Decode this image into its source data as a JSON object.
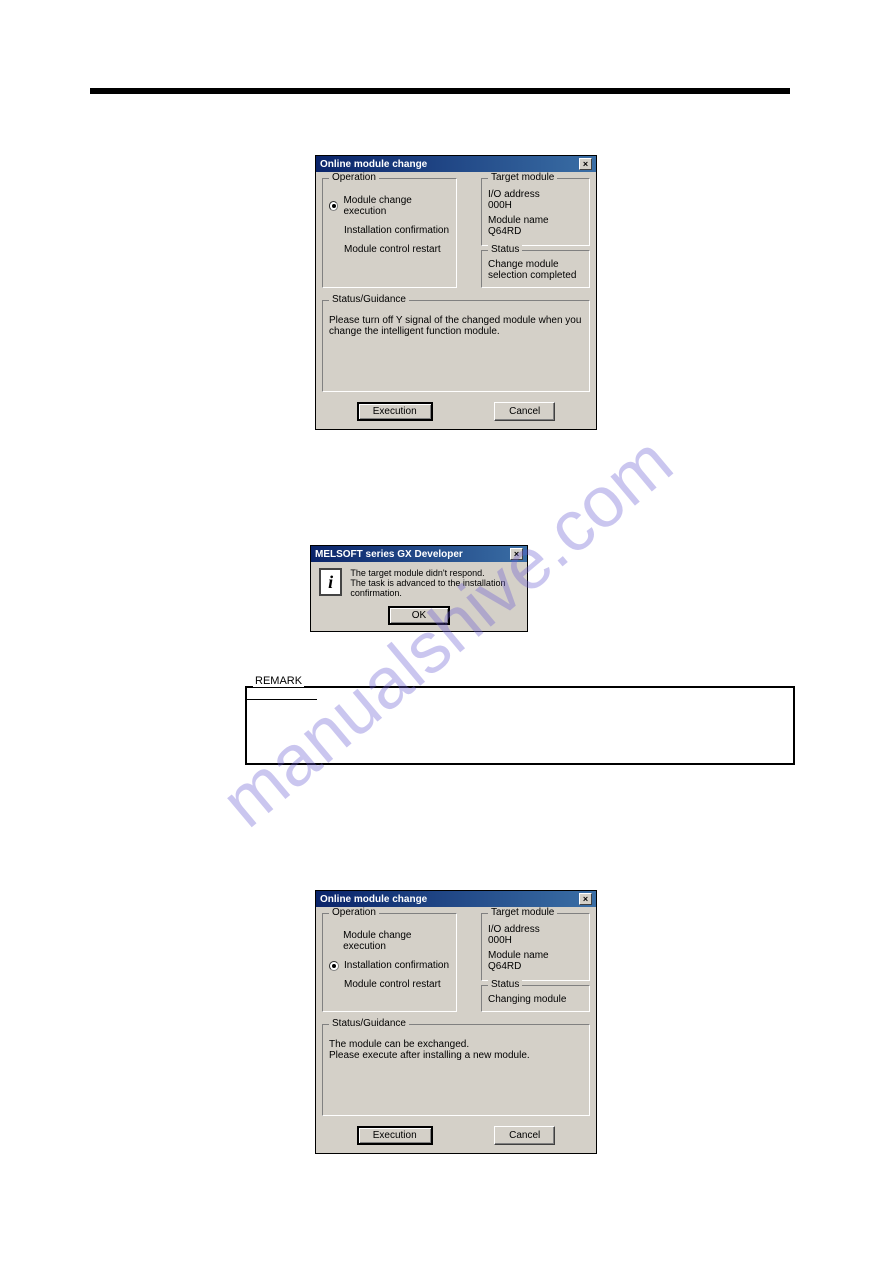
{
  "watermark": "manualshive.com",
  "dialog1": {
    "title": "Online module change",
    "operation": {
      "legend": "Operation",
      "opt1": "Module change execution",
      "opt2": "Installation confirmation",
      "opt3": "Module control restart"
    },
    "target": {
      "legend": "Target module",
      "io_label": "I/O address",
      "io_value": "000H",
      "name_label": "Module name",
      "name_value": "Q64RD"
    },
    "status": {
      "legend": "Status",
      "text": "Change module selection completed"
    },
    "guidance": {
      "legend": "Status/Guidance",
      "text": "Please turn off Y signal of the changed module when you change the intelligent function module."
    },
    "buttons": {
      "execute": "Execution",
      "cancel": "Cancel"
    }
  },
  "msgbox": {
    "title": "MELSOFT series GX Developer",
    "line1": "The target module didn't respond.",
    "line2": "The task is advanced to the installation confirmation.",
    "ok": "OK"
  },
  "remark": {
    "label": "REMARK"
  },
  "dialog2": {
    "title": "Online module change",
    "operation": {
      "legend": "Operation",
      "opt1": "Module change execution",
      "opt2": "Installation confirmation",
      "opt3": "Module control restart"
    },
    "target": {
      "legend": "Target module",
      "io_label": "I/O address",
      "io_value": "000H",
      "name_label": "Module name",
      "name_value": "Q64RD"
    },
    "status": {
      "legend": "Status",
      "text": "Changing module"
    },
    "guidance": {
      "legend": "Status/Guidance",
      "line1": "The module can be exchanged.",
      "line2": "Please execute after installing a new module."
    },
    "buttons": {
      "execute": "Execution",
      "cancel": "Cancel"
    }
  }
}
